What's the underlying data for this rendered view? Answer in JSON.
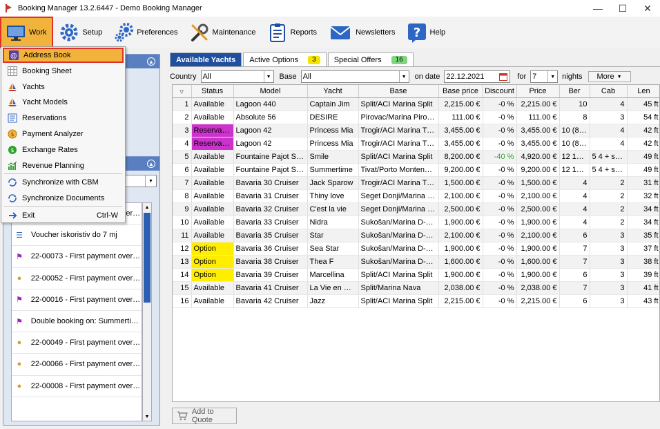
{
  "window": {
    "title": "Booking Manager 13.2.6447 - Demo Booking Manager"
  },
  "toolbar": [
    {
      "label": "Work",
      "icon": "monitor-icon",
      "active": true
    },
    {
      "label": "Setup",
      "icon": "gear-icon"
    },
    {
      "label": "Preferences",
      "icon": "gears-icon"
    },
    {
      "label": "Maintenance",
      "icon": "wrench-icon"
    },
    {
      "label": "Reports",
      "icon": "clipboard-icon"
    },
    {
      "label": "Newsletters",
      "icon": "envelope-icon"
    },
    {
      "label": "Help",
      "icon": "help-icon"
    }
  ],
  "menu": {
    "items": [
      {
        "label": "Address Book",
        "icon": "at-icon",
        "highlight": true
      },
      {
        "label": "Booking Sheet",
        "icon": "grid-icon"
      },
      {
        "label": "Yachts",
        "icon": "sailboat-icon"
      },
      {
        "label": "Yacht Models",
        "icon": "sailboat-icon"
      },
      {
        "label": "Reservations",
        "icon": "list-icon"
      },
      {
        "label": "Payment Analyzer",
        "icon": "coins-icon"
      },
      {
        "label": "Exchange Rates",
        "icon": "exchange-icon"
      },
      {
        "label": "Revenue Planning",
        "icon": "chart-icon"
      },
      {
        "label": "Synchronize with CBM",
        "icon": "sync-icon"
      },
      {
        "label": "Synchronize Documents",
        "icon": "sync-icon"
      },
      {
        "label": "Exit",
        "icon": "exit-icon",
        "shortcut": "Ctrl-W"
      }
    ]
  },
  "tasks": [
    {
      "text": "21-03505 - First payment overd...",
      "icon": "coin-icon"
    },
    {
      "text": "Voucher iskoristiv do 7 mj",
      "icon": "checklist-icon"
    },
    {
      "text": "22-00073 - First payment overd...",
      "icon": "flag-icon"
    },
    {
      "text": "22-00052 - First payment overd...",
      "icon": "coin-icon"
    },
    {
      "text": "22-00016 - First payment overd...",
      "icon": "flag-icon"
    },
    {
      "text": "Double booking on: Summertim...",
      "icon": "flag-icon"
    },
    {
      "text": "22-00049 - First payment overd...",
      "icon": "coin-icon"
    },
    {
      "text": "22-00066 - First payment overd...",
      "icon": "coin-icon"
    },
    {
      "text": "22-00008 - First payment overd...",
      "icon": "coin-icon"
    }
  ],
  "tabs": [
    {
      "label": "Available Yachts",
      "active": true
    },
    {
      "label": "Active Options",
      "badge": "3",
      "badge_color": "#f5e400"
    },
    {
      "label": "Special Offers",
      "badge": "16",
      "badge_color": "#7ed67e"
    }
  ],
  "filters": {
    "country_label": "Country",
    "country_value": "All",
    "base_label": "Base",
    "base_value": "All",
    "date_label": "on date",
    "date_value": "22.12.2021",
    "for_label": "for",
    "for_value": "7",
    "nights_label": "nights",
    "more_label": "More"
  },
  "grid": {
    "columns": [
      "",
      "Status",
      "Model",
      "Yacht",
      "Base",
      "Base price",
      "Discount",
      "Price",
      "Ber",
      "Cab",
      "Len"
    ],
    "rows": [
      [
        "1",
        "Available",
        "Lagoon 440",
        "Captain Jim",
        "Split/ACI Marina Split",
        "2,215.00 €",
        "-0 %",
        "2,215.00 €",
        "10",
        "4",
        "45 ft"
      ],
      [
        "2",
        "Available",
        "Absolute 56",
        "DESIRE",
        "Pirovac/Marina Pirovac",
        "111.00 €",
        "-0 %",
        "111.00 €",
        "8",
        "3",
        "54 ft"
      ],
      [
        "3",
        "Reservation",
        "Lagoon 42",
        "Princess Mia",
        "Trogir/ACI Marina Trogir",
        "3,455.00 €",
        "-0 %",
        "3,455.00 €",
        "10 (8+2)",
        "4",
        "42 ft"
      ],
      [
        "4",
        "Reservation",
        "Lagoon 42",
        "Princess Mia",
        "Trogir/ACI Marina Trogi...",
        "3,455.00 €",
        "-0 %",
        "3,455.00 €",
        "10 (8+2)",
        "4",
        "42 ft"
      ],
      [
        "5",
        "Available",
        "Fountaine Pajot SAB...",
        "Smile",
        "Split/ACI Marina Split",
        "8,200.00 €",
        "-40 %",
        "4,920.00 €",
        "12 10 ...",
        "5 4 + ski...",
        "49 ft"
      ],
      [
        "6",
        "Available",
        "Fountaine Pajot SAB...",
        "Summertime",
        "Tivat/Porto Montenegro",
        "9,200.00 €",
        "-0 %",
        "9,200.00 €",
        "12 10 ...",
        "5 4 + ski...",
        "49 ft"
      ],
      [
        "7",
        "Available",
        "Bavaria 30 Cruiser",
        "Jack Sparow",
        "Trogir/ACI Marina Trogir",
        "1,500.00 €",
        "-0 %",
        "1,500.00 €",
        "4",
        "2",
        "31 ft"
      ],
      [
        "8",
        "Available",
        "Bavaria 31 Cruiser",
        "Thiny love",
        "Seget Donji/Marina Ba...",
        "2,100.00 €",
        "-0 %",
        "2,100.00 €",
        "4",
        "2",
        "32 ft"
      ],
      [
        "9",
        "Available",
        "Bavaria 32 Cruiser",
        "C'est la vie",
        "Seget Donji/Marina Ba...",
        "2,500.00 €",
        "-0 %",
        "2,500.00 €",
        "4",
        "2",
        "34 ft"
      ],
      [
        "10",
        "Available",
        "Bavaria 33 Cruiser",
        "Nidra",
        "Sukošan/Marina D-Mar...",
        "1,900.00 €",
        "-0 %",
        "1,900.00 €",
        "4",
        "2",
        "34 ft"
      ],
      [
        "11",
        "Available",
        "Bavaria 35 Cruiser",
        "Star",
        "Sukošan/Marina D-Mar...",
        "2,100.00 €",
        "-0 %",
        "2,100.00 €",
        "6",
        "3",
        "35 ft"
      ],
      [
        "12",
        "Option",
        "Bavaria 36 Cruiser",
        "Sea Star",
        "Sukošan/Marina D-Mar...",
        "1,900.00 €",
        "-0 %",
        "1,900.00 €",
        "7",
        "3",
        "37 ft"
      ],
      [
        "13",
        "Option",
        "Bavaria 38 Cruiser",
        "Thea F",
        "Sukošan/Marina D-Mar...",
        "1,600.00 €",
        "-0 %",
        "1,600.00 €",
        "7",
        "3",
        "38 ft"
      ],
      [
        "14",
        "Option",
        "Bavaria 39 Cruiser",
        "Marcellina",
        "Split/ACI Marina Split",
        "1,900.00 €",
        "-0 %",
        "1,900.00 €",
        "6",
        "3",
        "39 ft"
      ],
      [
        "15",
        "Available",
        "Bavaria 41 Cruiser",
        "La Vie en Rose",
        "Split/Marina Nava",
        "2,038.00 €",
        "-0 %",
        "2,038.00 €",
        "7",
        "3",
        "41 ft"
      ],
      [
        "16",
        "Available",
        "Bavaria 42 Cruiser",
        "Jazz",
        "Split/ACI Marina Split",
        "2,215.00 €",
        "-0 %",
        "2,215.00 €",
        "6",
        "3",
        "43 ft"
      ]
    ]
  },
  "quote_button": {
    "label": "Add to Quote"
  },
  "colors": {
    "reservation": "#cc33cc",
    "option": "#ffee00",
    "discount": "#2aa52a",
    "accent": "#f2b33d",
    "highlight_border": "#e0302a",
    "tab_active": "#1f4fa0"
  }
}
